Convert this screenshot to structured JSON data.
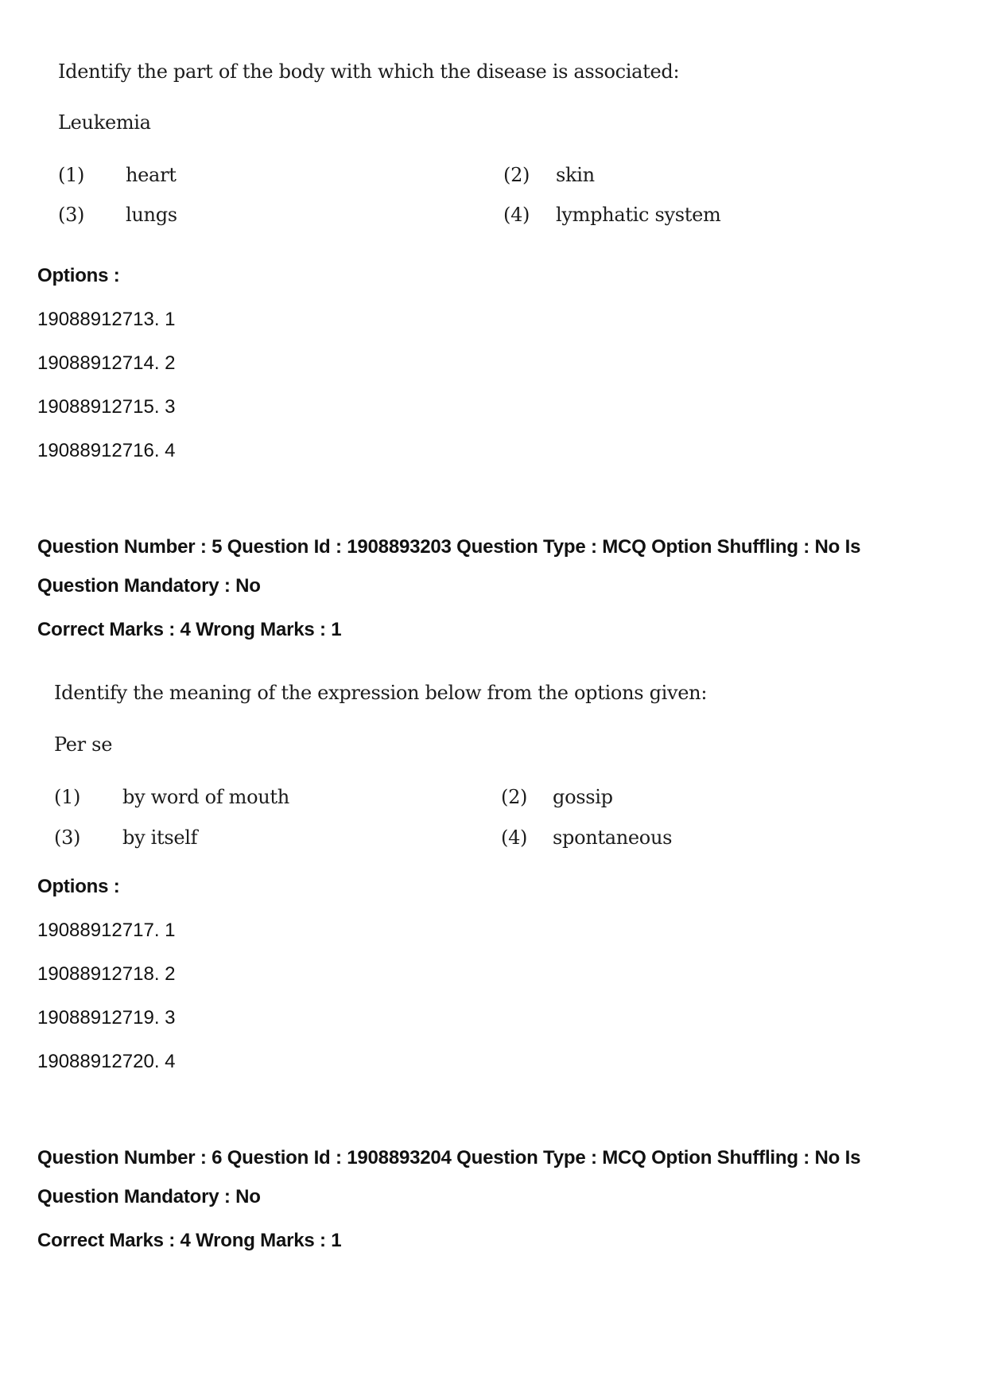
{
  "questions": [
    {
      "prompt": "Identify the part of the body with which the disease is associated:",
      "term": "Leukemia",
      "choices": [
        {
          "num": "(1)",
          "text": "heart"
        },
        {
          "num": "(2)",
          "text": "skin"
        },
        {
          "num": "(3)",
          "text": "lungs"
        },
        {
          "num": "(4)",
          "text": "lymphatic system"
        }
      ],
      "options_label": "Options :",
      "options": [
        "19088912713. 1",
        "19088912714. 2",
        "19088912715. 3",
        "19088912716. 4"
      ]
    },
    {
      "header_line1": "Question Number : 5 Question Id : 1908893203 Question Type : MCQ Option Shuffling : No Is",
      "header_line2": "Question Mandatory : No",
      "marks": "Correct Marks : 4 Wrong Marks : 1",
      "prompt": "Identify the meaning of the expression below from the options given:",
      "term": "Per se",
      "choices": [
        {
          "num": "(1)",
          "text": "by word of mouth"
        },
        {
          "num": "(2)",
          "text": "gossip"
        },
        {
          "num": "(3)",
          "text": "by itself"
        },
        {
          "num": "(4)",
          "text": "spontaneous"
        }
      ],
      "options_label": "Options :",
      "options": [
        "19088912717. 1",
        "19088912718. 2",
        "19088912719. 3",
        "19088912720. 4"
      ]
    },
    {
      "header_line1": "Question Number : 6 Question Id : 1908893204 Question Type : MCQ Option Shuffling : No Is",
      "header_line2": "Question Mandatory : No",
      "marks": "Correct Marks : 4 Wrong Marks : 1"
    }
  ]
}
